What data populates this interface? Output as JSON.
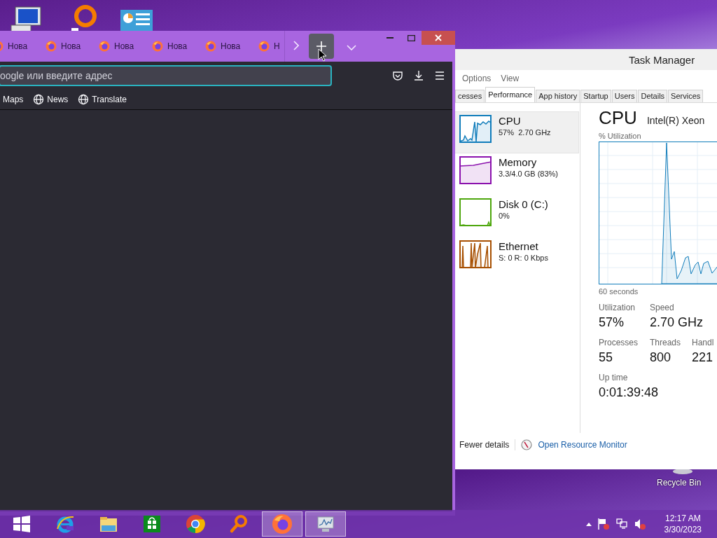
{
  "desktop": {
    "recycle_bin": {
      "label": "Recycle Bin"
    }
  },
  "browser": {
    "tabs": [
      {
        "title": "Нова",
        "selected": false
      },
      {
        "title": "Нова",
        "selected": false
      },
      {
        "title": "Нова",
        "selected": false
      },
      {
        "title": "Нова",
        "selected": false
      },
      {
        "title": "Нова",
        "selected": false
      },
      {
        "title": "Н",
        "selected": false
      }
    ],
    "address_bar": {
      "placeholder": "oogle или введите адрес"
    },
    "bookmarks": [
      {
        "label": "Maps"
      },
      {
        "label": "News"
      },
      {
        "label": "Translate"
      }
    ]
  },
  "task_manager": {
    "title": "Task Manager",
    "menu": [
      "Options",
      "View"
    ],
    "tabs": [
      {
        "label": "cesses",
        "selected": false
      },
      {
        "label": "Performance",
        "selected": true
      },
      {
        "label": "App history",
        "selected": false
      },
      {
        "label": "Startup",
        "selected": false
      },
      {
        "label": "Users",
        "selected": false
      },
      {
        "label": "Details",
        "selected": false
      },
      {
        "label": "Services",
        "selected": false
      }
    ],
    "resources": [
      {
        "kind": "cpu",
        "name": "CPU",
        "detail": "57%  2.70 GHz",
        "selected": true,
        "color": "#117dbb"
      },
      {
        "kind": "memory",
        "name": "Memory",
        "detail": "3.3/4.0 GB (83%)",
        "selected": false,
        "color": "#8b12ae"
      },
      {
        "kind": "disk",
        "name": "Disk 0 (C:)",
        "detail": "0%",
        "selected": false,
        "color": "#4da60c"
      },
      {
        "kind": "network",
        "name": "Ethernet",
        "detail": "S: 0 R: 0 Kbps",
        "selected": false,
        "color": "#a74f01"
      }
    ],
    "detail": {
      "title": "CPU",
      "model": "Intel(R) Xeon",
      "graph_label": "% Utilization",
      "time_span": "60 seconds",
      "stat_rows": [
        [
          {
            "label": "Utilization",
            "value": "57%"
          },
          {
            "label": "Speed",
            "value": "2.70 GHz"
          }
        ],
        [
          {
            "label": "Processes",
            "value": "55"
          },
          {
            "label": "Threads",
            "value": "800"
          },
          {
            "label": "Handl",
            "value": "221"
          }
        ],
        [
          {
            "label": "Up time",
            "value": "0:01:39:48"
          }
        ]
      ]
    },
    "footer": {
      "fewer_details": "Fewer details",
      "resource_monitor": "Open Resource Monitor"
    }
  },
  "taskbar": {
    "apps": [
      {
        "kind": "start",
        "active": false
      },
      {
        "kind": "ie",
        "active": false
      },
      {
        "kind": "explorer",
        "active": false
      },
      {
        "kind": "store",
        "active": false
      },
      {
        "kind": "chrome",
        "active": false
      },
      {
        "kind": "search",
        "active": false
      },
      {
        "kind": "firefox",
        "active": true
      },
      {
        "kind": "taskmgr",
        "active": true
      }
    ],
    "clock": {
      "time": "12:17 AM",
      "date": "3/30/2023"
    }
  }
}
